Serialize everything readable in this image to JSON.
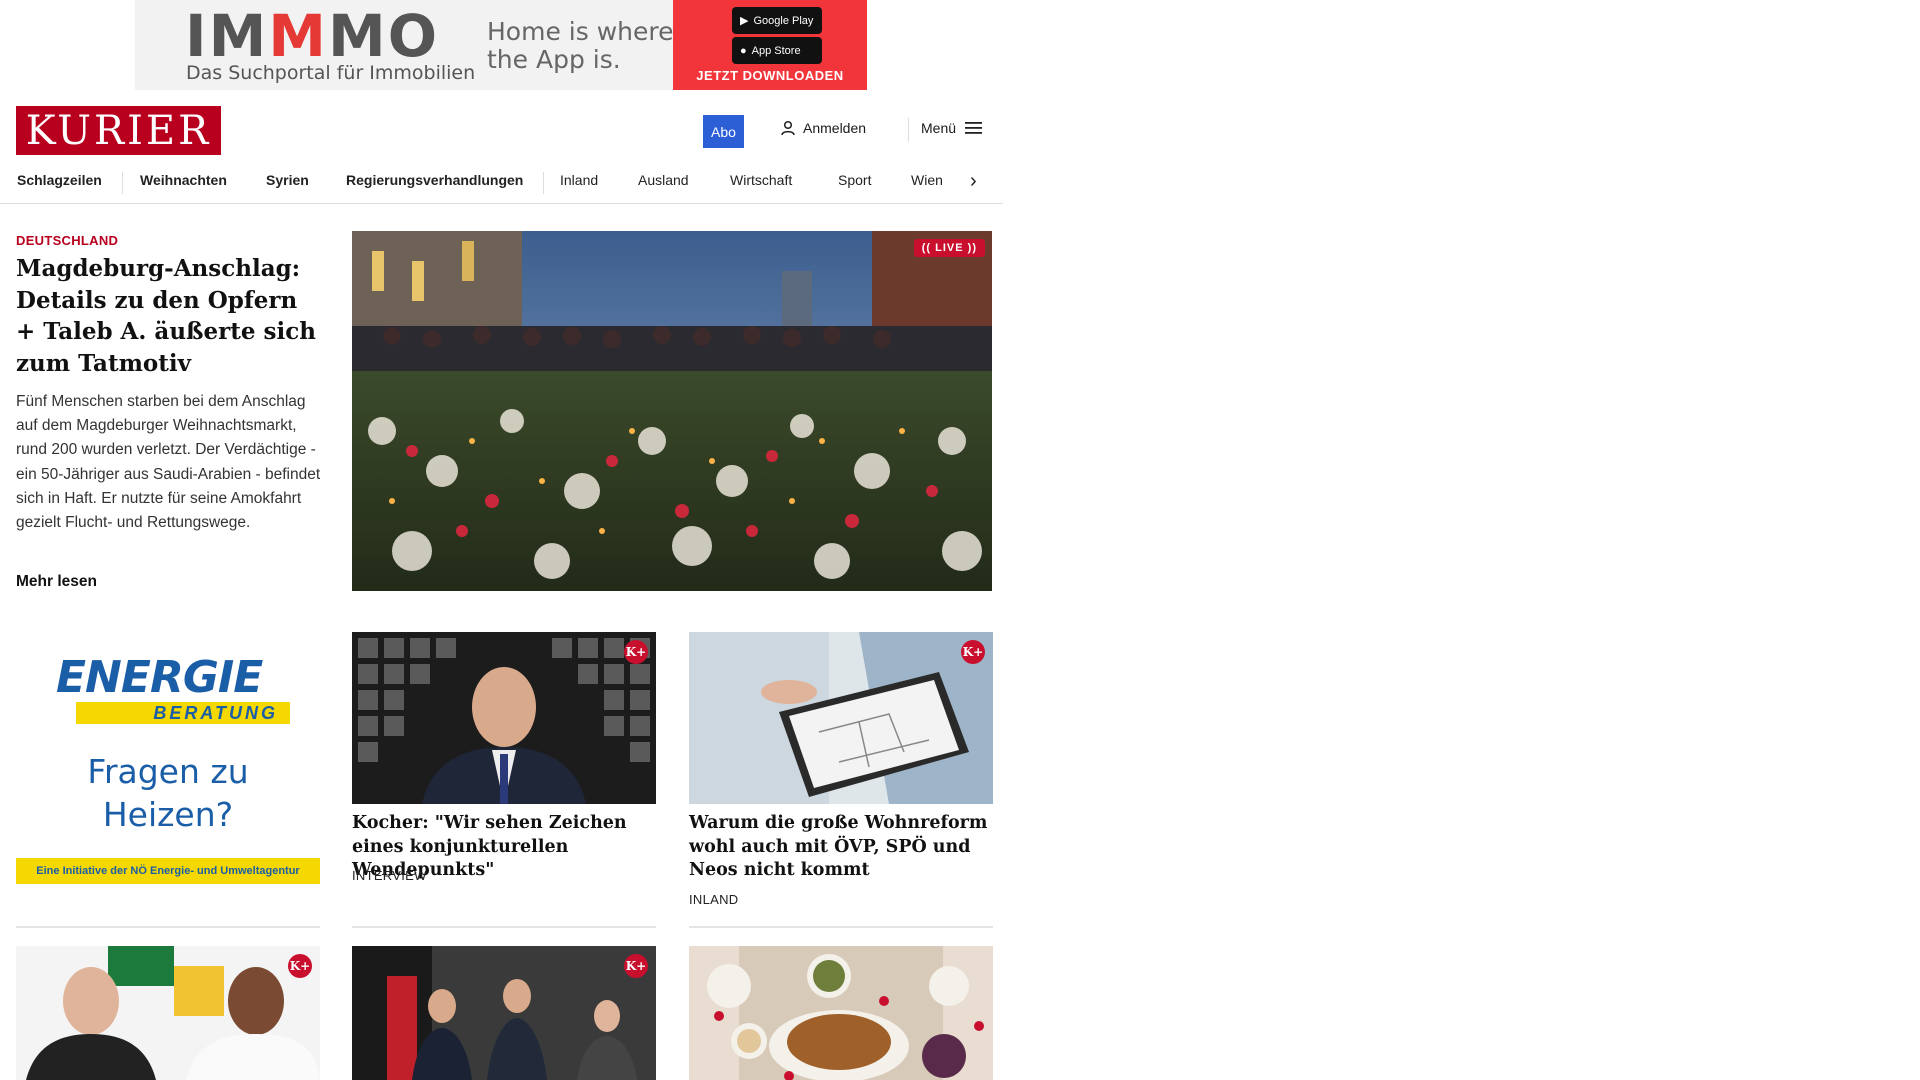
{
  "ad_top": {
    "brand": "IMMMO",
    "subtitle": "Das Suchportal für Immobilien",
    "tagline_line1": "Home is where",
    "tagline_line2": "the App is.",
    "google_play": "Google Play",
    "app_store": "App Store",
    "cta": "JETZT DOWNLOADEN"
  },
  "header": {
    "logo": "KURIER",
    "abo": "Abo",
    "login": "Anmelden",
    "menu": "Menü"
  },
  "nav": {
    "items": [
      "Schlagzeilen",
      "Weihnachten",
      "Syrien",
      "Regierungsverhandlungen",
      "Inland",
      "Ausland",
      "Wirtschaft",
      "Sport",
      "Wien"
    ]
  },
  "lead": {
    "kicker": "DEUTSCHLAND",
    "title": "Magdeburg-Anschlag: Details zu den Opfern + Taleb A. äußerte sich zum Tatmotiv",
    "teaser": "Fünf Menschen starben bei dem Anschlag auf dem Magdeburger Weihnachtsmarkt, rund 200 wurden verletzt. Der Verdächtige - ein 50-Jähriger aus Saudi-Arabien - befindet sich in Haft. Er nutzte für seine Amokfahrt gezielt Flucht- und Rettungswege.",
    "more": "Mehr lesen",
    "live": "LIVE"
  },
  "side_ad": {
    "brand": "ENERGIE",
    "beratung": "BERATUNG",
    "headline_line1": "Fragen zu",
    "headline_line2": "Heizen?",
    "footer": "Eine Initiative der NÖ Energie- und Umweltagentur"
  },
  "cards": [
    {
      "title": "Kocher: \"Wir sehen Zeichen eines konjunkturellen Wendepunkts\"",
      "tag": "INTERVIEW",
      "badge": "K+"
    },
    {
      "title": "Warum die große Wohnreform wohl auch mit ÖVP, SPÖ und Neos nicht kommt",
      "tag": "INLAND",
      "badge": "K+"
    }
  ],
  "bottom_badges": [
    "K+",
    "K+"
  ]
}
